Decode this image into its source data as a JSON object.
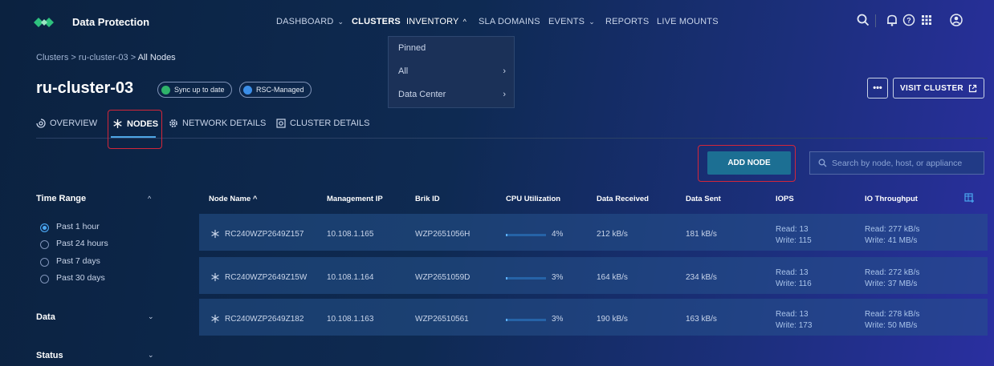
{
  "header": {
    "app_title": "Data Protection",
    "nav": [
      {
        "label": "DASHBOARD",
        "chevron": "down"
      },
      {
        "label": "CLUSTERS",
        "active": true
      },
      {
        "label": "INVENTORY",
        "chevron": "up"
      },
      {
        "label": "SLA DOMAINS"
      },
      {
        "label": "EVENTS",
        "chevron": "down"
      },
      {
        "label": "REPORTS"
      },
      {
        "label": "LIVE MOUNTS"
      }
    ],
    "inventory_menu": [
      "Pinned",
      "All",
      "Data Center"
    ]
  },
  "breadcrumb": {
    "part1": "Clusters",
    "sep": ">",
    "part2": "ru-cluster-03",
    "part3": "All Nodes"
  },
  "cluster": {
    "name": "ru-cluster-03",
    "badges": [
      {
        "label": "Sync up to date",
        "color": "#2fb36a"
      },
      {
        "label": "RSC-Managed",
        "color": "#3b8ee8"
      }
    ],
    "more_label": "•••",
    "visit_label": "VISIT CLUSTER"
  },
  "tabs": [
    {
      "label": "OVERVIEW",
      "icon": "overview-icon"
    },
    {
      "label": "NODES",
      "icon": "nodes-icon",
      "active": true
    },
    {
      "label": "NETWORK DETAILS",
      "icon": "gear-icon"
    },
    {
      "label": "CLUSTER DETAILS",
      "icon": "cluster-details-icon"
    }
  ],
  "actions": {
    "add_node": "ADD NODE",
    "search_placeholder": "Search by node, host, or appliance"
  },
  "sidebar": {
    "time_range": {
      "title": "Time Range",
      "options": [
        "Past 1 hour",
        "Past 24 hours",
        "Past 7 days",
        "Past 30 days"
      ],
      "selected": "Past 1 hour"
    },
    "data_title": "Data",
    "status_title": "Status"
  },
  "table": {
    "columns": [
      "Node Name",
      "Management IP",
      "Brik ID",
      "CPU Utilization",
      "Data Received",
      "Data Sent",
      "IOPS",
      "IO Throughput"
    ],
    "sort_indicator": "^",
    "rows": [
      {
        "name": "RC240WZP2649Z157",
        "ip": "10.108.1.165",
        "brik": "WZP2651056H",
        "cpu": "4%",
        "cpu_value": 4,
        "received": "212 kB/s",
        "sent": "181 kB/s",
        "iops_read": "Read: 13",
        "iops_write": "Write: 115",
        "tp_read": "Read: 277 kB/s",
        "tp_write": "Write: 41 MB/s"
      },
      {
        "name": "RC240WZP2649Z15W",
        "ip": "10.108.1.164",
        "brik": "WZP2651059D",
        "cpu": "3%",
        "cpu_value": 3,
        "received": "164 kB/s",
        "sent": "234 kB/s",
        "iops_read": "Read: 13",
        "iops_write": "Write: 116",
        "tp_read": "Read: 272 kB/s",
        "tp_write": "Write: 37 MB/s"
      },
      {
        "name": "RC240WZP2649Z182",
        "ip": "10.108.1.163",
        "brik": "WZP26510561",
        "cpu": "3%",
        "cpu_value": 3,
        "received": "190 kB/s",
        "sent": "163 kB/s",
        "iops_read": "Read: 13",
        "iops_write": "Write: 173",
        "tp_read": "Read: 278 kB/s",
        "tp_write": "Write: 50 MB/s"
      }
    ]
  },
  "colors": {
    "accent": "#4ea7e6",
    "highlight": "#d3263a",
    "primary_button": "#1c6f93"
  }
}
